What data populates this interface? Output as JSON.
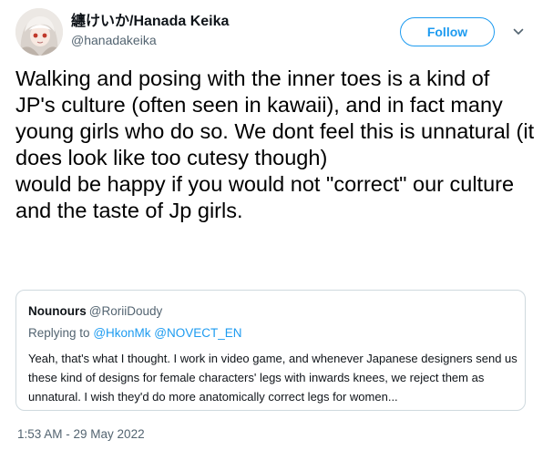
{
  "author": {
    "display_name": "纏けいか/Hanada Keika",
    "handle": "@hanadakeika",
    "avatar_icon": "anime-girl-avatar-icon"
  },
  "actions": {
    "follow_label": "Follow",
    "more_icon": "chevron-down-icon"
  },
  "tweet": {
    "text": "Walking and posing with the inner toes is a kind of JP's culture (often seen in kawaii), and in fact many young girls who do so. We dont feel this is unnatural (it does look like too cutesy though)\nwould be happy if you would not \"correct\" our culture and the taste of Jp girls."
  },
  "quoted": {
    "name": "Nounours",
    "handle": "@RoriiDoudy",
    "replying_prefix": "Replying to",
    "mentions": [
      "@HkonMk",
      "@NOVECT_EN"
    ],
    "text": "Yeah, that's what I thought. I work in video game, and whenever Japanese designers send us these kind of designs for female characters' legs with inwards knees, we reject them as unnatural. I wish they'd do more anatomically correct legs for women..."
  },
  "timestamp": "1:53 AM - 29 May 2022",
  "colors": {
    "accent": "#1d9bf0",
    "secondary_text": "#536471",
    "border": "#cfd9de"
  }
}
